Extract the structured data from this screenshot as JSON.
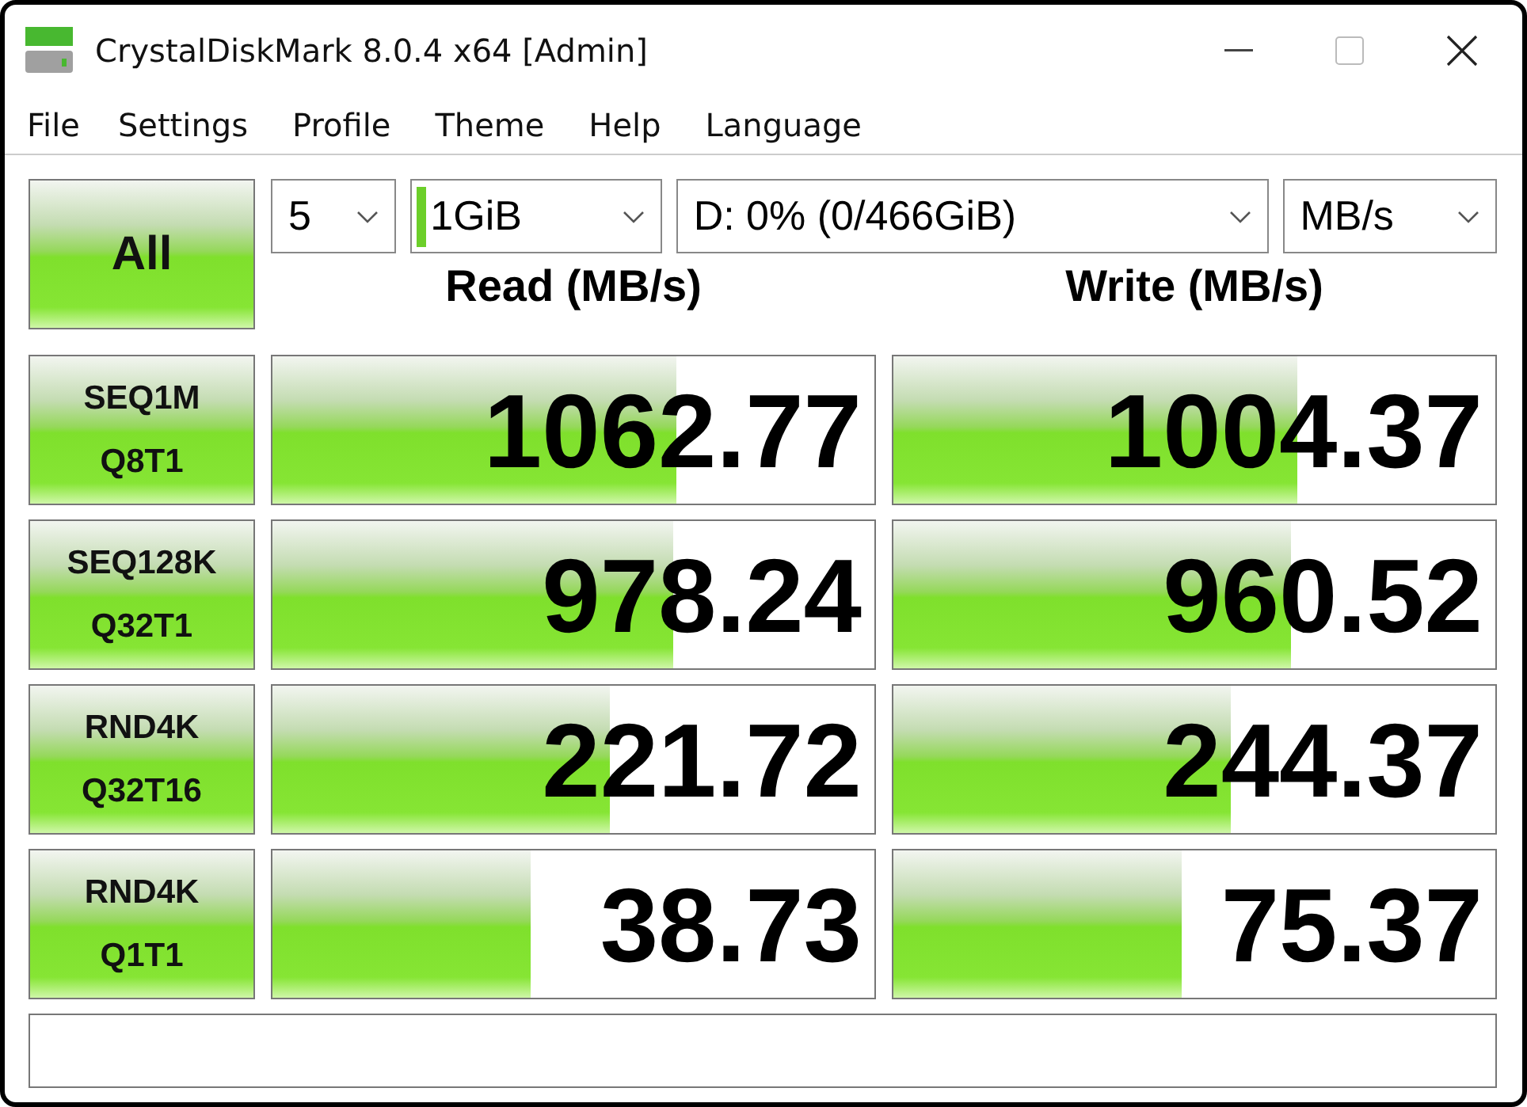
{
  "window": {
    "title": "CrystalDiskMark 8.0.4 x64 [Admin]"
  },
  "menu": [
    "File",
    "Settings",
    "Profile",
    "Theme",
    "Help",
    "Language"
  ],
  "all_button": "All",
  "controls": {
    "count": "5",
    "size": "1GiB",
    "drive": "D: 0% (0/466GiB)",
    "unit": "MB/s"
  },
  "headers": {
    "read": "Read (MB/s)",
    "write": "Write (MB/s)"
  },
  "tests": [
    {
      "line1": "SEQ1M",
      "line2": "Q8T1",
      "read": {
        "value": "1062.77",
        "level": 0.67
      },
      "write": {
        "value": "1004.37",
        "level": 0.67
      }
    },
    {
      "line1": "SEQ128K",
      "line2": "Q32T1",
      "read": {
        "value": "978.24",
        "level": 0.665
      },
      "write": {
        "value": "960.52",
        "level": 0.66
      }
    },
    {
      "line1": "RND4K",
      "line2": "Q32T16",
      "read": {
        "value": "221.72",
        "level": 0.56
      },
      "write": {
        "value": "244.37",
        "level": 0.56
      }
    },
    {
      "line1": "RND4K",
      "line2": "Q1T1",
      "read": {
        "value": "38.73",
        "level": 0.43
      },
      "write": {
        "value": "75.37",
        "level": 0.48
      }
    }
  ]
}
